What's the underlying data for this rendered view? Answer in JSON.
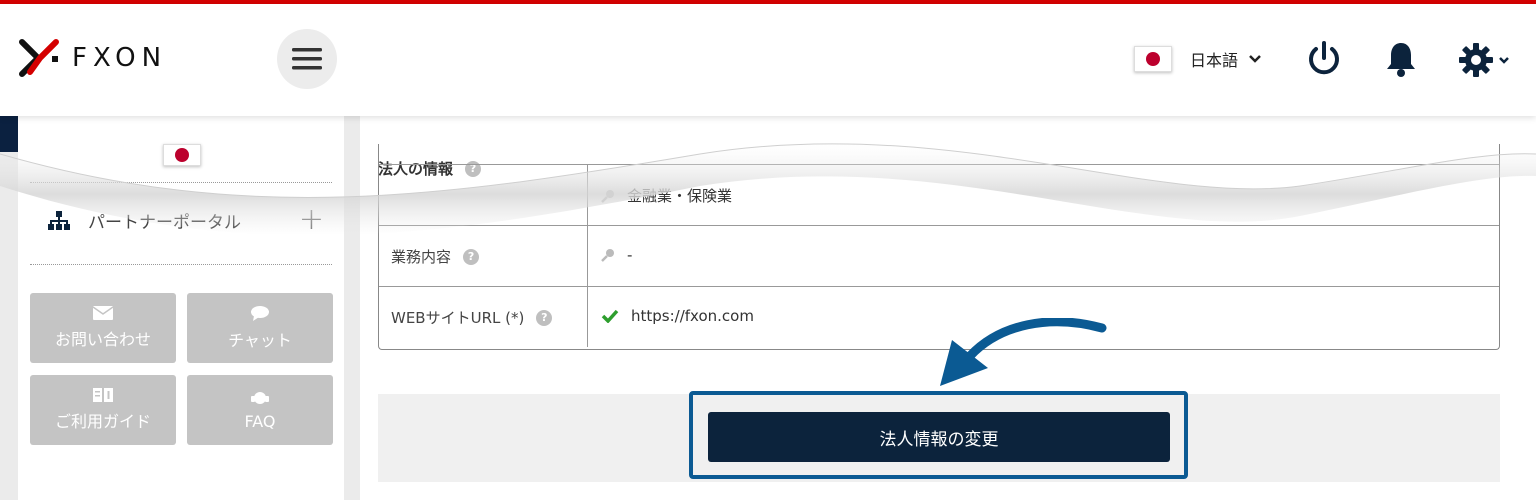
{
  "header": {
    "logo_text": "FXON",
    "language": "日本語",
    "icons": [
      "menu-icon",
      "power-icon",
      "bell-icon",
      "gear-icon"
    ]
  },
  "sidebar": {
    "partner_portal": "パートナーポータル",
    "tiles": [
      {
        "label": "お問い合わせ",
        "icon": "mail-icon"
      },
      {
        "label": "チャット",
        "icon": "chat-icon"
      },
      {
        "label": "ご利用ガイド",
        "icon": "guide-icon"
      },
      {
        "label": "FAQ",
        "icon": "faq-icon"
      }
    ]
  },
  "main": {
    "section_title": "法人の情報",
    "rows": [
      {
        "label": "",
        "value": "金融業・保険業"
      },
      {
        "label": "業務内容",
        "value": "-"
      },
      {
        "label": "WEBサイトURL (*)",
        "value": "https://fxon.com"
      }
    ],
    "change_button": "法人情報の変更"
  },
  "colors": {
    "brand_red": "#d40000",
    "navy": "#0c233c",
    "highlight_blue": "#0b5a93",
    "check_green": "#2e9e2e"
  }
}
